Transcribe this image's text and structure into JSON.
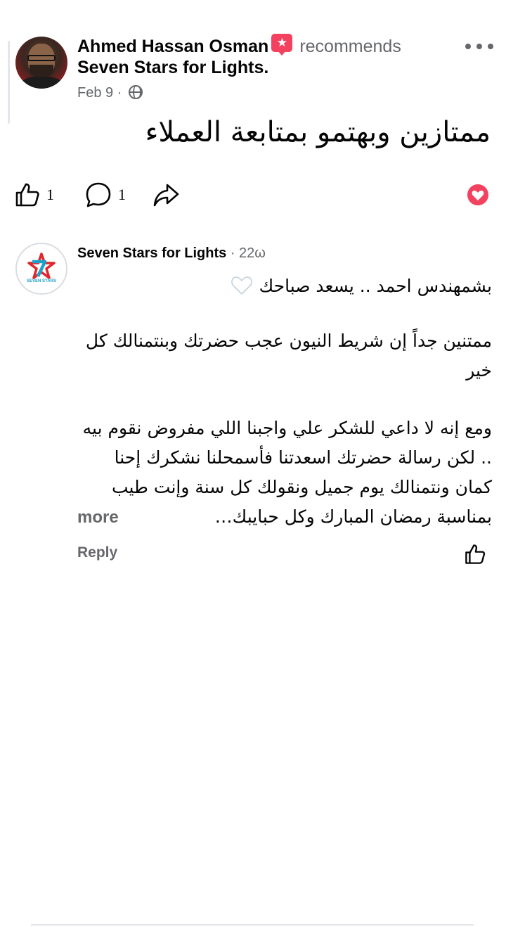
{
  "post": {
    "author": "Ahmed Hassan Osman",
    "action": "recommends",
    "page": "Seven Stars for Lights.",
    "date": "Feb 9",
    "dot": "·",
    "body": "ممتازين وبهتمو بمتابعة العملاء",
    "like_count": "1",
    "comment_count": "1"
  },
  "comment": {
    "author": "Seven Stars for Lights",
    "time": " · 22ω",
    "line1": "بشمهندس احمد .. يسعد صباحك",
    "para2": "ممتنين جداً إن شريط النيون عجب حضرتك وبنتمنالك كل خير",
    "para3": "ومع إنه لا داعي للشكر علي واجبنا اللي مفروض نقوم بيه .. لكن رسالة حضرتك اسعدتنا فأسمحلنا نشكرك إحنا كمان ونتمنالك يوم جميل ونقولك كل سنة وإنت طيب",
    "para3_last": "بمناسبة رمضان المبارك وكل حبايبك…",
    "see_more": "more",
    "reply": "Reply",
    "logo_text": "SEVEN STARS"
  },
  "icons": {
    "recommend": "recommend-badge-icon",
    "globe": "globe-icon",
    "more": "more-options-icon",
    "like": "thumbs-up-icon",
    "comment": "comment-bubble-icon",
    "share": "share-arrow-icon",
    "love": "love-reaction-icon",
    "white_heart": "white-heart-icon"
  },
  "colors": {
    "text": "#050505",
    "secondary": "#65676b",
    "love": "#f3425f",
    "logo_red": "#e0262b",
    "logo_blue": "#1ea1c8"
  }
}
